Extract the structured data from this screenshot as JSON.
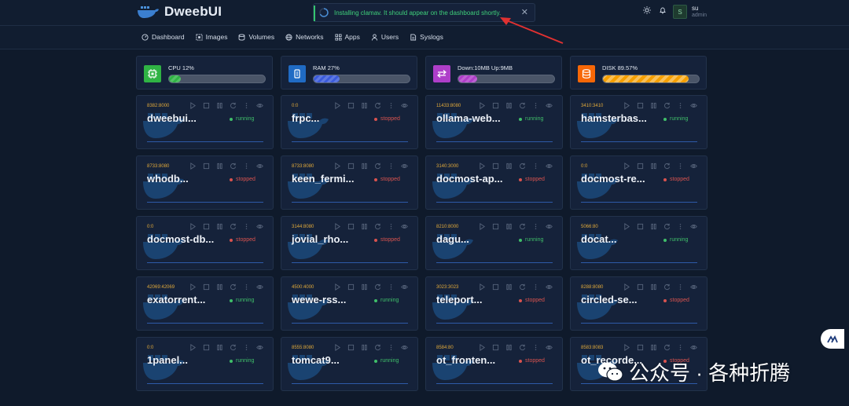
{
  "app": {
    "title": "DweebUI"
  },
  "toast": {
    "message": "Installing clamav. It should appear on the dashboard shortly.",
    "close": "✕"
  },
  "user": {
    "avatar": "S",
    "name": "su",
    "role": "admin"
  },
  "nav": [
    {
      "label": "Dashboard",
      "icon": "dashboard-icon"
    },
    {
      "label": "Images",
      "icon": "images-icon"
    },
    {
      "label": "Volumes",
      "icon": "volumes-icon"
    },
    {
      "label": "Networks",
      "icon": "networks-icon"
    },
    {
      "label": "Apps",
      "icon": "apps-icon"
    },
    {
      "label": "Users",
      "icon": "users-icon"
    },
    {
      "label": "Syslogs",
      "icon": "syslogs-icon"
    }
  ],
  "stats": [
    {
      "label": "CPU 12%",
      "value": 0.12,
      "color": "#2fb344",
      "fill": "#2fb344",
      "icon": "cpu-icon"
    },
    {
      "label": "RAM 27%",
      "value": 0.27,
      "color": "#206bc4",
      "fill": "#3b5bdb",
      "icon": "ram-icon"
    },
    {
      "label": "Down:10MB Up:9MB",
      "value": 0.2,
      "color": "#ae3ec9",
      "fill": "#ae3ec9",
      "icon": "network-arrows-icon"
    },
    {
      "label": "DISK 89.57%",
      "value": 0.8957,
      "color": "#f76707",
      "fill": "#f59f00",
      "icon": "database-icon"
    }
  ],
  "containers": [
    {
      "port": "8382:8000",
      "name": "dweebui...",
      "status": "running"
    },
    {
      "port": "0:0",
      "name": "frpc...",
      "status": "stopped"
    },
    {
      "port": "11433:8080",
      "name": "ollama-web...",
      "status": "running"
    },
    {
      "port": "3410:3410",
      "name": "hamsterbas...",
      "status": "running"
    },
    {
      "port": "8733:8080",
      "name": "whodb...",
      "status": "stopped"
    },
    {
      "port": "8733:8080",
      "name": "keen_fermi...",
      "status": "stopped"
    },
    {
      "port": "3140:3000",
      "name": "docmost-ap...",
      "status": "stopped"
    },
    {
      "port": "0:0",
      "name": "docmost-re...",
      "status": "stopped"
    },
    {
      "port": "0:0",
      "name": "docmost-db...",
      "status": "stopped"
    },
    {
      "port": "3144:8080",
      "name": "jovial_rho...",
      "status": "stopped"
    },
    {
      "port": "8210:8000",
      "name": "dagu...",
      "status": "running"
    },
    {
      "port": "5066:80",
      "name": "docat...",
      "status": "running"
    },
    {
      "port": "42069:42069",
      "name": "exatorrent...",
      "status": "running"
    },
    {
      "port": "4500:4000",
      "name": "wewe-rss...",
      "status": "running"
    },
    {
      "port": "3023:3023",
      "name": "teleport...",
      "status": "stopped"
    },
    {
      "port": "8288:8080",
      "name": "circled-se...",
      "status": "stopped"
    },
    {
      "port": "0:0",
      "name": "1panel...",
      "status": "running"
    },
    {
      "port": "8555:8080",
      "name": "tomcat9...",
      "status": "running"
    },
    {
      "port": "8584:80",
      "name": "ot_fronten...",
      "status": "stopped"
    },
    {
      "port": "8583:8083",
      "name": "ot_recorde...",
      "status": "stopped"
    }
  ],
  "watermark": {
    "text": "公众号 · 各种折腾"
  },
  "colors": {
    "running": "#3fbf6a",
    "stopped": "#d9534f",
    "port": "#e0a93a"
  }
}
